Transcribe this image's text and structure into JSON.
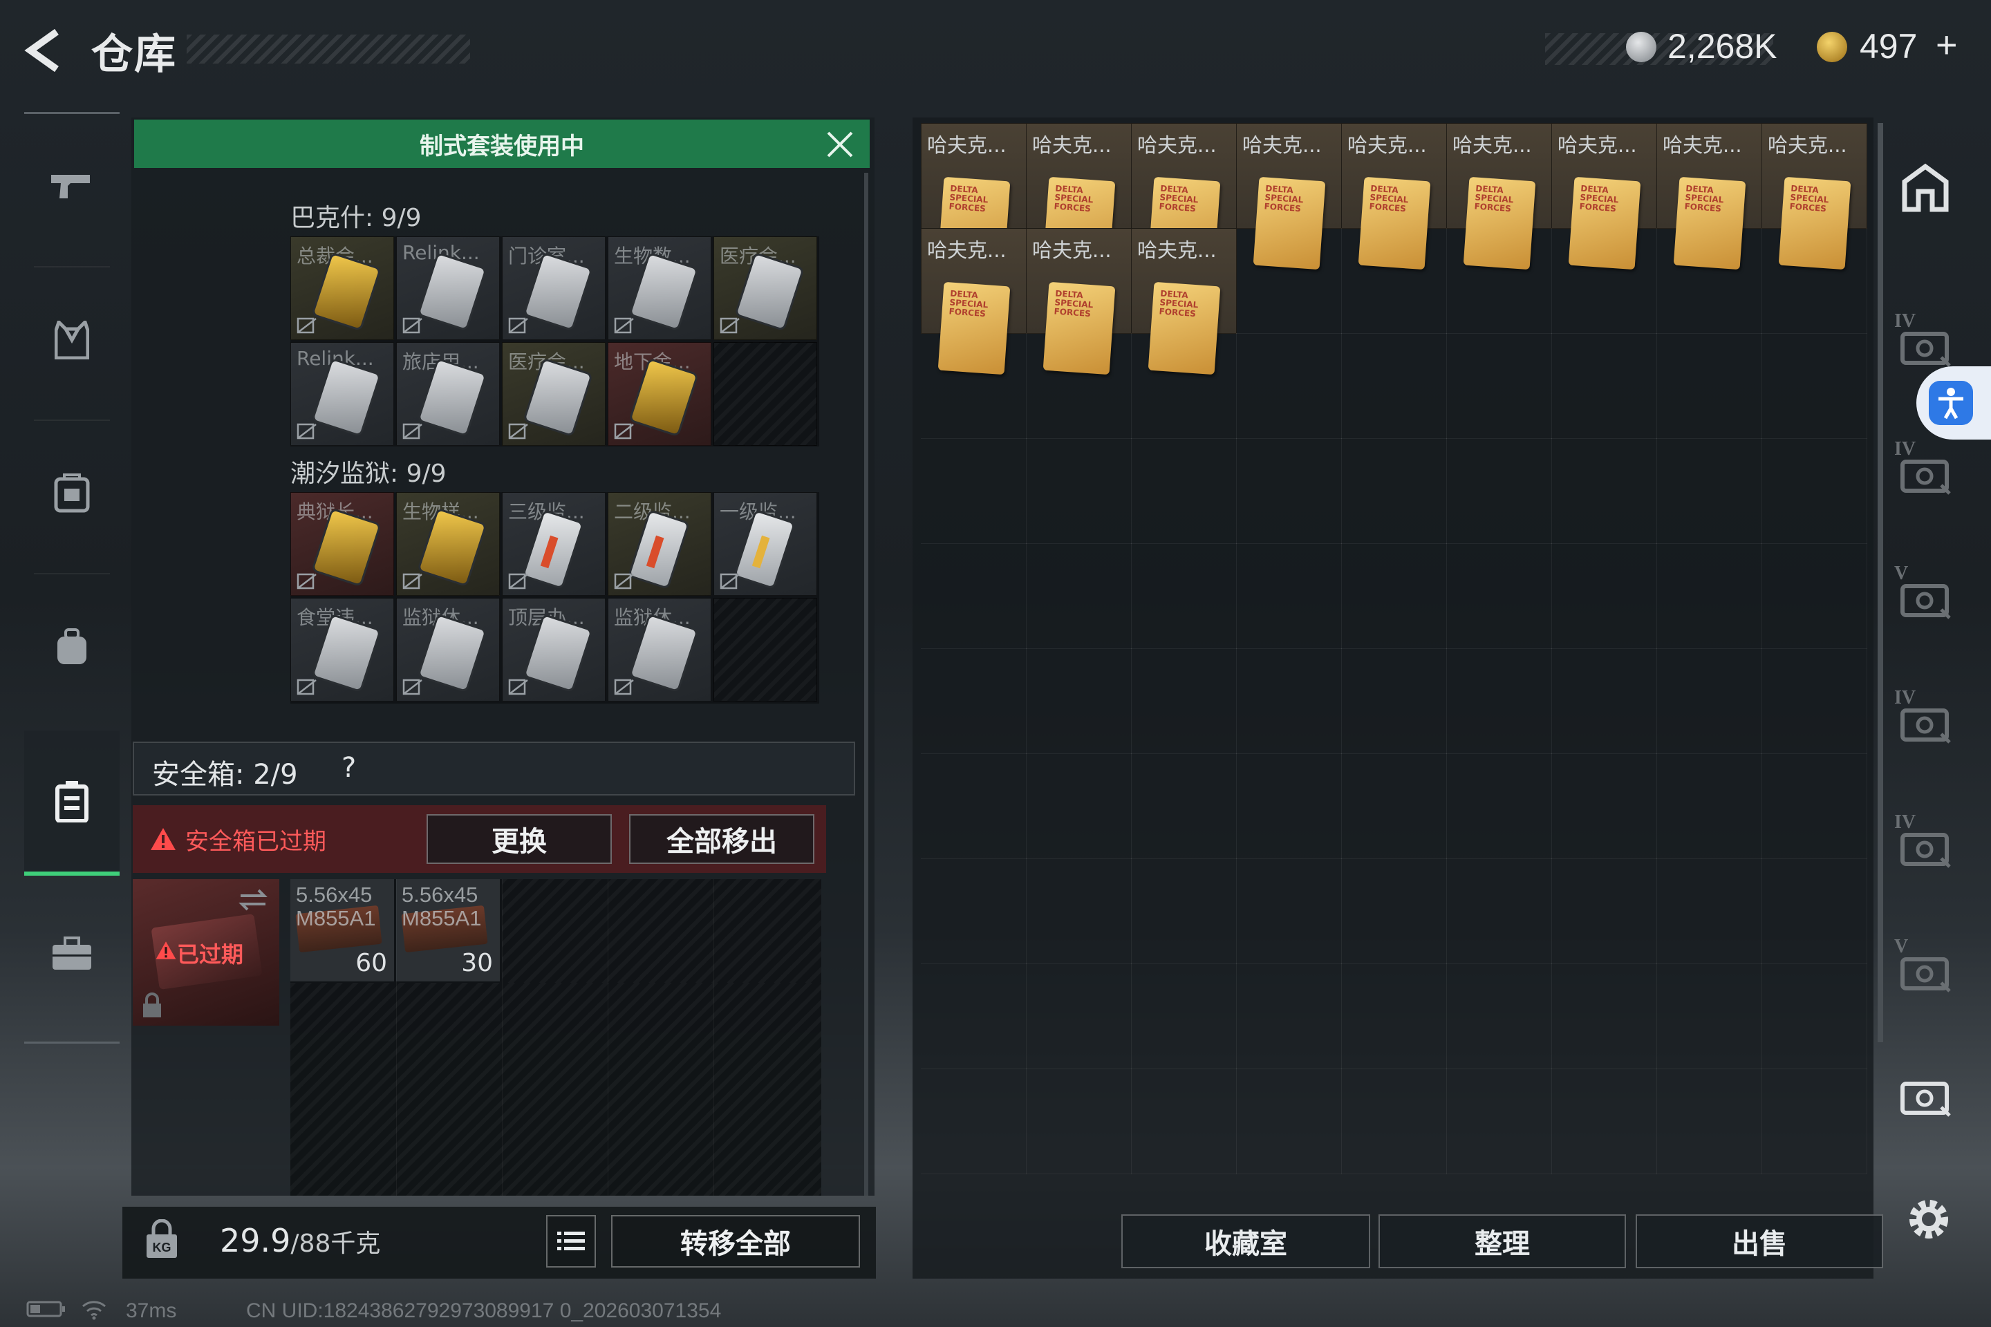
{
  "header": {
    "title": "仓库",
    "currency1": "2,268K",
    "currency2": "497",
    "plus": "+"
  },
  "nav": {
    "items": [
      "weapon",
      "armor",
      "backpack",
      "chest-rig",
      "safe-box",
      "briefcase"
    ]
  },
  "left": {
    "banner": "制式套装使用中",
    "section1": {
      "label": "巴克什: 9/9",
      "items": [
        "总裁会...",
        "Relink...",
        "门诊室...",
        "生物数...",
        "医疗会...",
        "Relink...",
        "旅店用...",
        "医疗会...",
        "地下金..."
      ]
    },
    "section2": {
      "label": "潮汐监狱: 9/9",
      "items": [
        "典狱长...",
        "生物样...",
        "三级监...",
        "二级监...",
        "一级监...",
        "食堂违...",
        "监狱休...",
        "顶层办...",
        "监狱休..."
      ]
    },
    "safe_box": {
      "label": "安全箱: 2/9",
      "help": "?",
      "warning": "安全箱已过期",
      "replace": "更换",
      "move_all": "全部移出",
      "expired": "已过期",
      "ammo": [
        {
          "name1": "5.56x45",
          "name2": "M855A1",
          "count": "60"
        },
        {
          "name1": "5.56x45",
          "name2": "M855A1",
          "count": "30"
        }
      ]
    },
    "weight": "29.9",
    "weight_unit": "/88千克",
    "transfer_all": "转移全部"
  },
  "right": {
    "items": [
      "哈夫克...",
      "哈夫克...",
      "哈夫克...",
      "哈夫克...",
      "哈夫克...",
      "哈夫克...",
      "哈夫克...",
      "哈夫克...",
      "哈夫克...",
      "哈夫克...",
      "哈夫克...",
      "哈夫克..."
    ],
    "doc_text": "DELTA SPECIAL FORCES",
    "collection": "收藏室",
    "sort": "整理",
    "sell": "出售",
    "side_labels": [
      "IV",
      "IV",
      "V",
      "IV",
      "IV",
      "V"
    ]
  },
  "status": {
    "ping": "37ms",
    "uid": "CN UID:18243862792973089917 0_202603071354"
  }
}
